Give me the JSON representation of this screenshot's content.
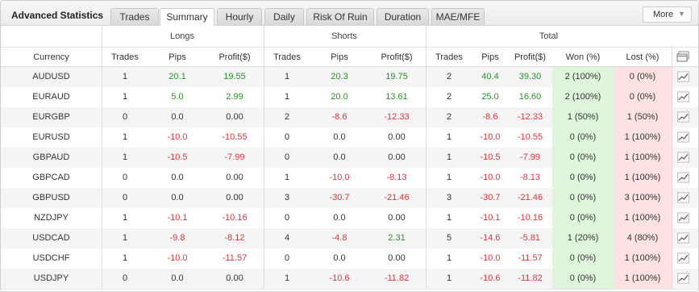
{
  "panel": {
    "title": "Advanced Statistics"
  },
  "tabs": [
    {
      "label": "Trades",
      "active": false
    },
    {
      "label": "Summary",
      "active": true
    },
    {
      "label": "Hourly",
      "active": false
    },
    {
      "label": "Daily",
      "active": false
    },
    {
      "label": "Risk Of Ruin",
      "active": false
    },
    {
      "label": "Duration",
      "active": false
    },
    {
      "label": "MAE/MFE",
      "active": false
    }
  ],
  "more_button": {
    "label": "More"
  },
  "groups": {
    "longs": "Longs",
    "shorts": "Shorts",
    "total": "Total"
  },
  "columns": [
    "Currency",
    "Trades",
    "Pips",
    "Profit($)",
    "Trades",
    "Pips",
    "Profit($)",
    "Trades",
    "Pips",
    "Profit($)",
    "Won (%)",
    "Lost (%)"
  ],
  "colors": {
    "positive": "#2d8f2d",
    "negative": "#e0343e",
    "won_bg": "#dff5dc",
    "lost_bg": "#fde2e2"
  },
  "rows": [
    {
      "currency": "AUDUSD",
      "l_trades": "1",
      "l_pips": "20.1",
      "l_profit": "19.55",
      "s_trades": "1",
      "s_pips": "20.3",
      "s_profit": "19.75",
      "t_trades": "2",
      "t_pips": "40.4",
      "t_profit": "39.30",
      "won": "2 (100%)",
      "lost": "0 (0%)"
    },
    {
      "currency": "EURAUD",
      "l_trades": "1",
      "l_pips": "5.0",
      "l_profit": "2.99",
      "s_trades": "1",
      "s_pips": "20.0",
      "s_profit": "13.61",
      "t_trades": "2",
      "t_pips": "25.0",
      "t_profit": "16.60",
      "won": "2 (100%)",
      "lost": "0 (0%)"
    },
    {
      "currency": "EURGBP",
      "l_trades": "0",
      "l_pips": "0.0",
      "l_profit": "0.00",
      "s_trades": "2",
      "s_pips": "-8.6",
      "s_profit": "-12.33",
      "t_trades": "2",
      "t_pips": "-8.6",
      "t_profit": "-12.33",
      "won": "1 (50%)",
      "lost": "1 (50%)"
    },
    {
      "currency": "EURUSD",
      "l_trades": "1",
      "l_pips": "-10.0",
      "l_profit": "-10.55",
      "s_trades": "0",
      "s_pips": "0.0",
      "s_profit": "0.00",
      "t_trades": "1",
      "t_pips": "-10.0",
      "t_profit": "-10.55",
      "won": "0 (0%)",
      "lost": "1 (100%)"
    },
    {
      "currency": "GBPAUD",
      "l_trades": "1",
      "l_pips": "-10.5",
      "l_profit": "-7.99",
      "s_trades": "0",
      "s_pips": "0.0",
      "s_profit": "0.00",
      "t_trades": "1",
      "t_pips": "-10.5",
      "t_profit": "-7.99",
      "won": "0 (0%)",
      "lost": "1 (100%)"
    },
    {
      "currency": "GBPCAD",
      "l_trades": "0",
      "l_pips": "0.0",
      "l_profit": "0.00",
      "s_trades": "1",
      "s_pips": "-10.0",
      "s_profit": "-8.13",
      "t_trades": "1",
      "t_pips": "-10.0",
      "t_profit": "-8.13",
      "won": "0 (0%)",
      "lost": "1 (100%)"
    },
    {
      "currency": "GBPUSD",
      "l_trades": "0",
      "l_pips": "0.0",
      "l_profit": "0.00",
      "s_trades": "3",
      "s_pips": "-30.7",
      "s_profit": "-21.46",
      "t_trades": "3",
      "t_pips": "-30.7",
      "t_profit": "-21.46",
      "won": "0 (0%)",
      "lost": "3 (100%)"
    },
    {
      "currency": "NZDJPY",
      "l_trades": "1",
      "l_pips": "-10.1",
      "l_profit": "-10.16",
      "s_trades": "0",
      "s_pips": "0.0",
      "s_profit": "0.00",
      "t_trades": "1",
      "t_pips": "-10.1",
      "t_profit": "-10.16",
      "won": "0 (0%)",
      "lost": "1 (100%)"
    },
    {
      "currency": "USDCAD",
      "l_trades": "1",
      "l_pips": "-9.8",
      "l_profit": "-8.12",
      "s_trades": "4",
      "s_pips": "-4.8",
      "s_profit": "2.31",
      "t_trades": "5",
      "t_pips": "-14.6",
      "t_profit": "-5.81",
      "won": "1 (20%)",
      "lost": "4 (80%)"
    },
    {
      "currency": "USDCHF",
      "l_trades": "1",
      "l_pips": "-10.0",
      "l_profit": "-11.57",
      "s_trades": "0",
      "s_pips": "0.0",
      "s_profit": "0.00",
      "t_trades": "1",
      "t_pips": "-10.0",
      "t_profit": "-11.57",
      "won": "0 (0%)",
      "lost": "1 (100%)"
    },
    {
      "currency": "USDJPY",
      "l_trades": "0",
      "l_pips": "0.0",
      "l_profit": "0.00",
      "s_trades": "1",
      "s_pips": "-10.6",
      "s_profit": "-11.82",
      "t_trades": "1",
      "t_pips": "-10.6",
      "t_profit": "-11.82",
      "won": "0 (0%)",
      "lost": "1 (100%)"
    }
  ]
}
